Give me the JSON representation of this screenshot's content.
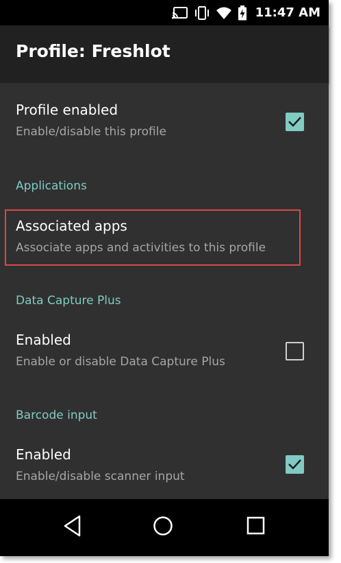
{
  "status": {
    "time": "11:47 AM",
    "icons": [
      "cast-icon",
      "vibrate-icon",
      "wifi-icon",
      "battery-charging-icon"
    ]
  },
  "appbar": {
    "title": "Profile: Freshlot"
  },
  "prefs": {
    "profile_enabled": {
      "title": "Profile enabled",
      "summary": "Enable/disable this profile",
      "checked": true
    },
    "applications_header": "Applications",
    "associated_apps": {
      "title": "Associated apps",
      "summary": "Associate apps and activities to this profile",
      "highlighted": true
    },
    "dcp_header": "Data Capture Plus",
    "dcp_enabled": {
      "title": "Enabled",
      "summary": "Enable or disable Data Capture Plus",
      "checked": false
    },
    "barcode_header": "Barcode input",
    "barcode_enabled": {
      "title": "Enabled",
      "summary": "Enable/disable scanner input",
      "checked": true
    }
  },
  "navbar": {
    "buttons": [
      "back-icon",
      "home-icon",
      "recents-icon"
    ]
  },
  "colors": {
    "accent": "#80cbc4",
    "highlight_border": "#e04747",
    "background": "#303030",
    "appbar": "#212121"
  }
}
